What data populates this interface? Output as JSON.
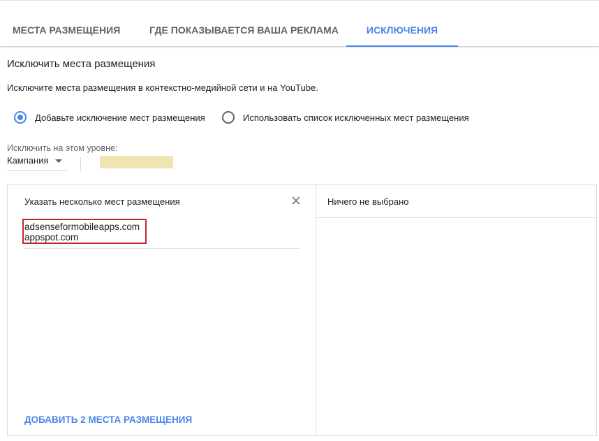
{
  "tabs": [
    {
      "label": "МЕСТА РАЗМЕЩЕНИЯ",
      "active": false
    },
    {
      "label": "ГДЕ ПОКАЗЫВАЕТСЯ ВАША РЕКЛАМА",
      "active": false
    },
    {
      "label": "ИСКЛЮЧЕНИЯ",
      "active": true
    }
  ],
  "section": {
    "title": "Исключить места размещения",
    "description": "Исключите места размещения в контекстно-медийной сети и на YouTube."
  },
  "options": [
    {
      "label": "Добавьте исключение мест размещения",
      "checked": true
    },
    {
      "label": "Использовать список исключенных мест размещения",
      "checked": false
    }
  ],
  "level": {
    "label": "Исключить на этом уровне:",
    "selected": "Кампания"
  },
  "left_panel": {
    "title": "Указать несколько мест размещения",
    "entries": [
      "adsenseformobileapps.com",
      "appspot.com"
    ],
    "add_button": "ДОБАВИТЬ 2 МЕСТА РАЗМЕЩЕНИЯ"
  },
  "right_panel": {
    "title": "Ничего не выбрано"
  },
  "colors": {
    "accent": "#4a86e8",
    "highlight_border": "#c62828",
    "redacted_fill": "#efe5b2"
  }
}
